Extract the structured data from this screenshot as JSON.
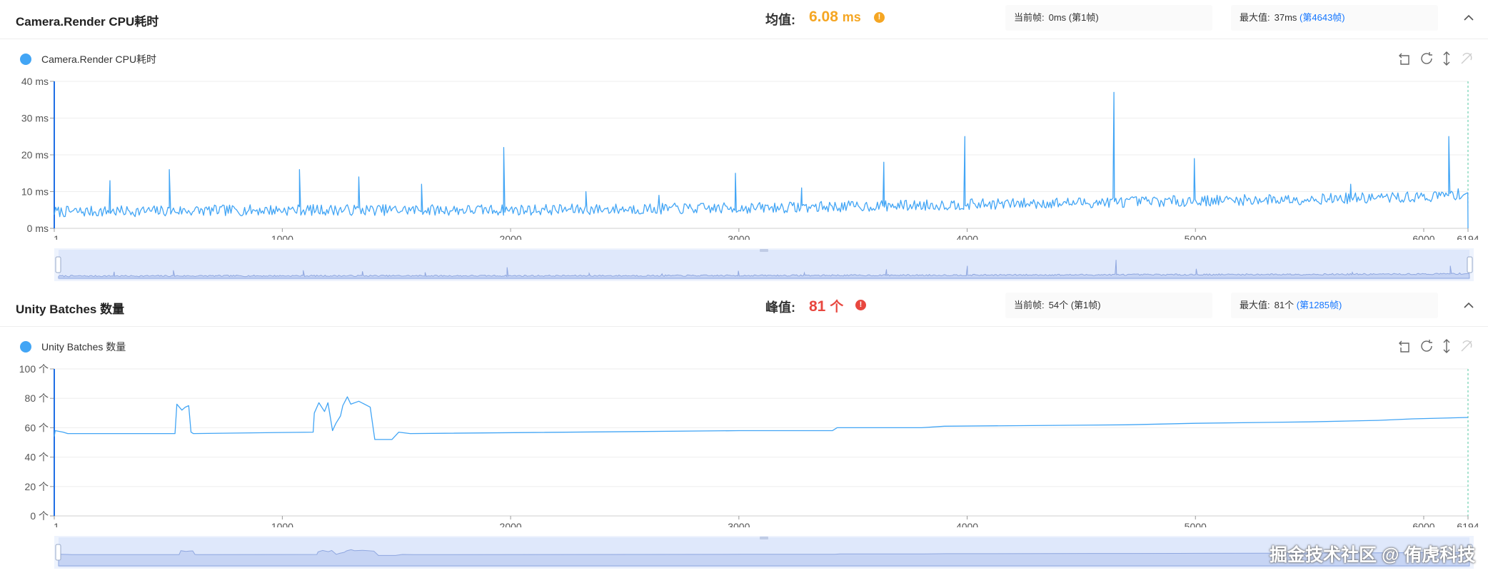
{
  "panels": [
    {
      "title": "Camera.Render CPU耗时",
      "stat_label": "均值:",
      "stat_value": "6.08",
      "stat_unit": "ms",
      "current_label": "当前帧:",
      "current_value": "0ms (第1帧)",
      "max_label": "最大值:",
      "max_value": "37ms",
      "max_link": "(第4643帧)",
      "legend": "Camera.Render CPU耗时"
    },
    {
      "title": "Unity Batches 数量",
      "stat_label": "峰值:",
      "stat_value": "81",
      "stat_unit": "个",
      "current_label": "当前帧:",
      "current_value": "54个 (第1帧)",
      "max_label": "最大值:",
      "max_value": "81个",
      "max_link": "(第1285帧)",
      "legend": "Unity Batches 数量"
    }
  ],
  "watermark": "掘金技术社区 @ 侑虎科技",
  "colors": {
    "series": "#42a5f5",
    "warn": "#f5a623",
    "error": "#e8473f",
    "link": "#1677ff",
    "slider_fill": "#dfe8fb"
  },
  "chart_data": [
    {
      "type": "line",
      "title": "Camera.Render CPU耗时",
      "xlim": [
        1,
        6194
      ],
      "ylim": [
        0,
        40
      ],
      "x_ticks": [
        "1",
        "1000",
        "2000",
        "3000",
        "4000",
        "5000",
        "6000",
        "6194"
      ],
      "y_ticks": [
        "0 ms",
        "10 ms",
        "20 ms",
        "30 ms",
        "40 ms"
      ],
      "series": [
        {
          "name": "Camera.Render CPU耗时",
          "baseline": [
            [
              1,
              4.5
            ],
            [
              1000,
              5
            ],
            [
              2000,
              5
            ],
            [
              3000,
              5.5
            ],
            [
              4000,
              6.5
            ],
            [
              5000,
              7.5
            ],
            [
              6000,
              8.5
            ],
            [
              6190,
              9.5
            ]
          ],
          "noise": 1.5,
          "spikes": [
            [
              245,
              13
            ],
            [
              505,
              16
            ],
            [
              1075,
              16
            ],
            [
              1335,
              14
            ],
            [
              1610,
              12
            ],
            [
              1970,
              22
            ],
            [
              2330,
              10
            ],
            [
              2650,
              9
            ],
            [
              2985,
              15
            ],
            [
              3275,
              11
            ],
            [
              3635,
              18
            ],
            [
              3990,
              25
            ],
            [
              4643,
              37
            ],
            [
              4995,
              19
            ],
            [
              5680,
              12
            ],
            [
              6110,
              25
            ]
          ],
          "end": [
            6194,
            0
          ]
        }
      ]
    },
    {
      "type": "line",
      "title": "Unity Batches 数量",
      "xlim": [
        1,
        6194
      ],
      "ylim": [
        0,
        100
      ],
      "x_ticks": [
        "1",
        "1000",
        "2000",
        "3000",
        "4000",
        "5000",
        "6000",
        "6194"
      ],
      "y_ticks": [
        "0 个",
        "20 个",
        "40 个",
        "60 个",
        "80 个",
        "100 个"
      ],
      "series": [
        {
          "name": "Unity Batches 数量",
          "points": [
            [
              1,
              54
            ],
            [
              5,
              58
            ],
            [
              40,
              57
            ],
            [
              60,
              56
            ],
            [
              530,
              56
            ],
            [
              538,
              76
            ],
            [
              560,
              72
            ],
            [
              575,
              74
            ],
            [
              590,
              75
            ],
            [
              600,
              57
            ],
            [
              610,
              56
            ],
            [
              1135,
              57
            ],
            [
              1140,
              70
            ],
            [
              1160,
              77
            ],
            [
              1185,
              71
            ],
            [
              1200,
              77
            ],
            [
              1220,
              58
            ],
            [
              1235,
              63
            ],
            [
              1255,
              68
            ],
            [
              1265,
              75
            ],
            [
              1285,
              81
            ],
            [
              1300,
              76
            ],
            [
              1335,
              78
            ],
            [
              1385,
              74
            ],
            [
              1405,
              52
            ],
            [
              1480,
              52
            ],
            [
              1510,
              57
            ],
            [
              1560,
              56
            ],
            [
              3000,
              58
            ],
            [
              3410,
              58
            ],
            [
              3430,
              60
            ],
            [
              3800,
              60
            ],
            [
              3900,
              61
            ],
            [
              4700,
              62
            ],
            [
              5000,
              63
            ],
            [
              5500,
              64
            ],
            [
              5800,
              65
            ],
            [
              5950,
              66
            ],
            [
              6194,
              67
            ]
          ]
        }
      ]
    }
  ]
}
